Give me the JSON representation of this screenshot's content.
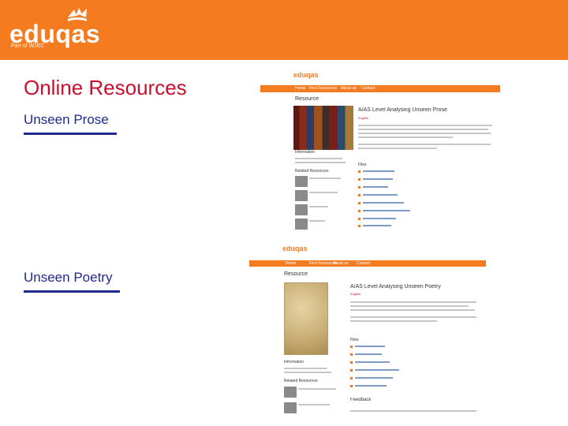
{
  "brand": {
    "name": "eduqas",
    "tagline": "Part of WJEC"
  },
  "page": {
    "title": "Online Resources"
  },
  "sections": [
    {
      "label": "Unseen Prose"
    },
    {
      "label": "Unseen Poetry"
    }
  ],
  "screenshots": [
    {
      "logo": "eduqas",
      "nav": [
        "Home",
        "Find Resources",
        "About us",
        "Contact"
      ],
      "heading": "Resource",
      "resource_title": "A/AS Level Analysing Unseen Prose",
      "subject": "English",
      "info_heading": "Information",
      "files_heading": "Files",
      "related_heading": "Related Resources"
    },
    {
      "logo": "eduqas",
      "nav": [
        "Home",
        "Find Resources",
        "About us",
        "Contact"
      ],
      "heading": "Resource",
      "resource_title": "A/AS Level Analysing Unseen Poetry",
      "subject": "English",
      "info_heading": "Information",
      "files_heading": "Files",
      "related_heading": "Related Resources",
      "feedback_heading": "Feedback"
    }
  ],
  "colors": {
    "brand_orange": "#f47b20",
    "title_red": "#c8102e",
    "section_blue": "#1f2a8c"
  }
}
